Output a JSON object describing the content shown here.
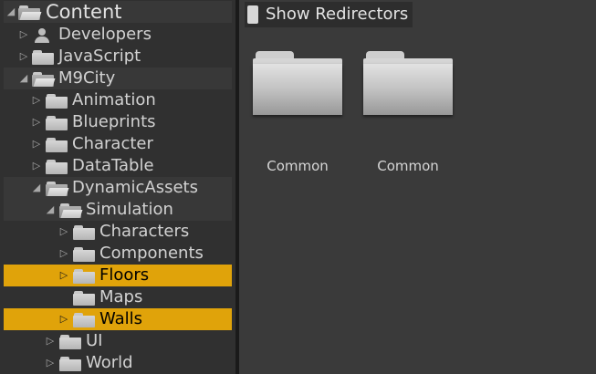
{
  "tree": {
    "root_label": "Content",
    "items": [
      {
        "label": "Developers"
      },
      {
        "label": "JavaScript"
      },
      {
        "label": "M9City"
      },
      {
        "label": "Animation"
      },
      {
        "label": "Blueprints"
      },
      {
        "label": "Character"
      },
      {
        "label": "DataTable"
      },
      {
        "label": "DynamicAssets"
      },
      {
        "label": "Simulation"
      },
      {
        "label": "Characters"
      },
      {
        "label": "Components"
      },
      {
        "label": "Floors"
      },
      {
        "label": "Maps"
      },
      {
        "label": "Walls"
      },
      {
        "label": "UI"
      },
      {
        "label": "World"
      }
    ]
  },
  "content": {
    "show_redirectors_label": "Show Redirectors",
    "assets": [
      {
        "label": "Common"
      },
      {
        "label": "Common"
      }
    ]
  },
  "colors": {
    "selection": "#e0a30a",
    "panel": "#303030",
    "content_bg": "#3a3a3a"
  }
}
